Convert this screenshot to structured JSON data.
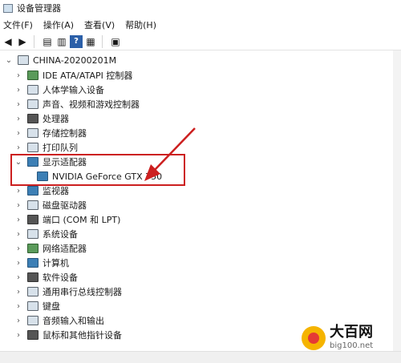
{
  "window": {
    "title": "设备管理器"
  },
  "menu": [
    "文件(F)",
    "操作(A)",
    "查看(V)",
    "帮助(H)"
  ],
  "computer": "CHINA-20200201M",
  "tree": [
    {
      "label": "IDE ATA/ATAPI 控制器",
      "icon": "ide-controller-icon"
    },
    {
      "label": "人体学输入设备",
      "icon": "hid-icon"
    },
    {
      "label": "声音、视频和游戏控制器",
      "icon": "speaker-icon"
    },
    {
      "label": "处理器",
      "icon": "processor-icon"
    },
    {
      "label": "存储控制器",
      "icon": "storage-icon"
    },
    {
      "label": "打印队列",
      "icon": "printer-icon"
    },
    {
      "label": "显示适配器",
      "icon": "display-adapter-icon",
      "expanded": true
    },
    {
      "label": "NVIDIA GeForce GTX 750",
      "icon": "gpu-icon",
      "child": true
    },
    {
      "label": "监视器",
      "icon": "monitor-icon"
    },
    {
      "label": "磁盘驱动器",
      "icon": "disk-icon"
    },
    {
      "label": "端口 (COM 和 LPT)",
      "icon": "port-icon"
    },
    {
      "label": "系统设备",
      "icon": "system-icon"
    },
    {
      "label": "网络适配器",
      "icon": "network-icon"
    },
    {
      "label": "计算机",
      "icon": "computer-icon"
    },
    {
      "label": "软件设备",
      "icon": "software-icon"
    },
    {
      "label": "通用串行总线控制器",
      "icon": "usb-icon"
    },
    {
      "label": "键盘",
      "icon": "keyboard-icon"
    },
    {
      "label": "音频输入和输出",
      "icon": "audio-icon"
    },
    {
      "label": "鼠标和其他指针设备",
      "icon": "mouse-icon"
    }
  ],
  "watermark": {
    "big": "大百网",
    "small": "big100.net"
  },
  "annotation_color": "#cc1f1f"
}
